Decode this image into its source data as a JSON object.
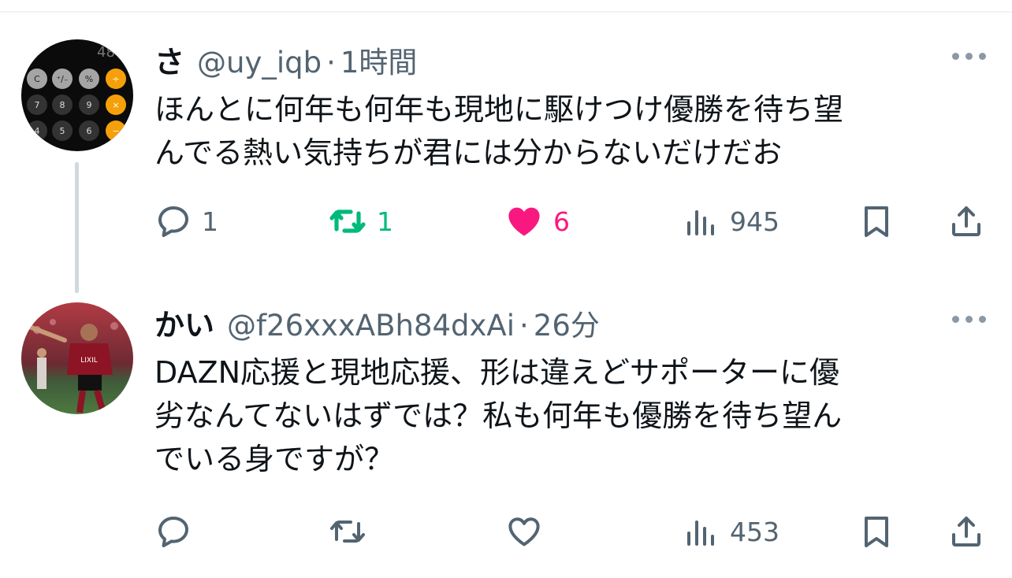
{
  "tweets": [
    {
      "name": "さ",
      "handle": "@uy_iqb",
      "time": "1時間",
      "text_lines": [
        "ほんとに何年も何年も現地に駆けつけ優勝を待ち望",
        "んでる熱い気持ちが君には分からないだけだお"
      ],
      "avatar": "calculator-keypad-photo",
      "reply_count": "1",
      "retweet_count": "1",
      "like_count": "6",
      "view_count": "945",
      "retweeted": true,
      "liked": true
    },
    {
      "name": "かい",
      "handle": "@f26xxxABh84dxAi",
      "time": "26分",
      "text_lines": [
        "DAZN応援と現地応援、形は違えどサポーターに優",
        "劣なんてないはずでは？私も何年も優勝を待ち望ん",
        "でいる身ですが？"
      ],
      "avatar": "soccer-player-photo",
      "reply_count": "",
      "retweet_count": "",
      "like_count": "",
      "view_count": "453",
      "retweeted": false,
      "liked": false
    }
  ],
  "icons": [
    "reply-icon",
    "retweet-icon",
    "like-icon",
    "views-icon",
    "bookmark-icon",
    "share-icon",
    "more-icon"
  ],
  "colors": {
    "text": "#0f1419",
    "secondary": "#536471",
    "retweet_active": "#00ba7c",
    "like_active": "#f91880",
    "thread_line": "#cfd9de"
  }
}
